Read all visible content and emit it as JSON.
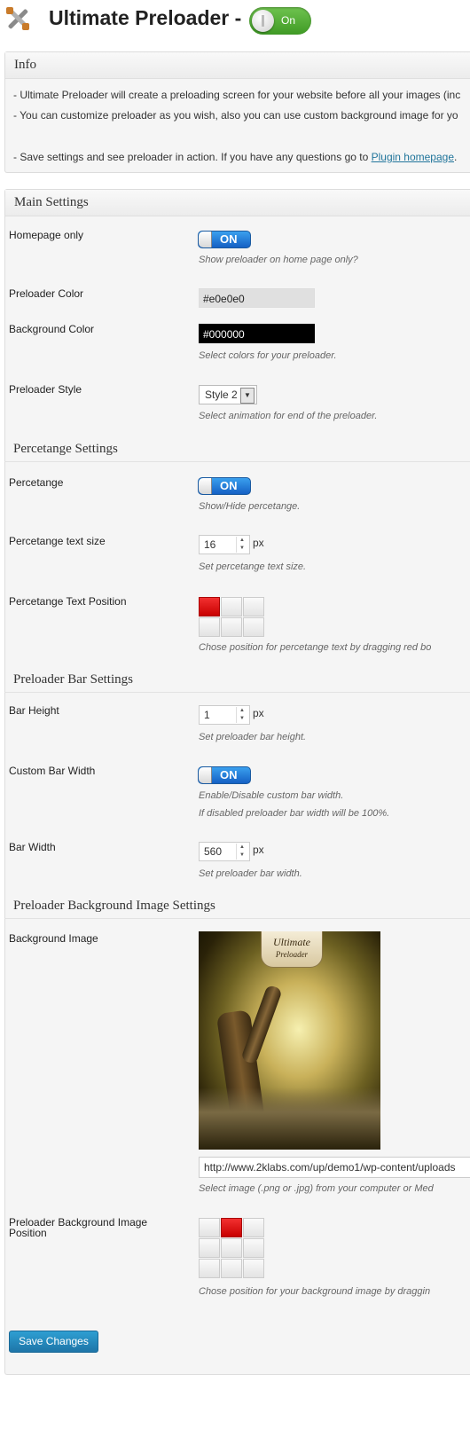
{
  "header": {
    "title": "Ultimate Preloader -",
    "toggle_label": "On",
    "icon": "tools-icon"
  },
  "info": {
    "title": "Info",
    "line1": "- Ultimate Preloader will create a preloading screen for your website before all your images (inc",
    "line2": "- You can customize preloader as you wish, also you can use custom background image for yo",
    "line3_prefix": "- Save settings and see preloader in action. If you have any questions go to ",
    "line3_link": "Plugin homepage",
    "line3_suffix": "."
  },
  "main_settings": {
    "title": "Main Settings",
    "homepage_only": {
      "label": "Homepage only",
      "toggle": "ON",
      "desc": "Show preloader on home page only?"
    },
    "preloader_color": {
      "label": "Preloader Color",
      "value": "#e0e0e0"
    },
    "background_color": {
      "label": "Background Color",
      "value": "#000000",
      "desc": "Select colors for your preloader."
    },
    "preloader_style": {
      "label": "Preloader Style",
      "value": "Style 2",
      "desc": "Select animation for end of the preloader."
    }
  },
  "percentage_settings": {
    "title": "Percetange Settings",
    "percentage": {
      "label": "Percetange",
      "toggle": "ON",
      "desc": "Show/Hide percetange."
    },
    "text_size": {
      "label": "Percetange text size",
      "value": "16",
      "unit": "px",
      "desc": "Set percetange text size."
    },
    "text_position": {
      "label": "Percetange Text Position",
      "desc": "Chose position for percetange text by dragging red bo",
      "selected_cell": 0
    }
  },
  "bar_settings": {
    "title": "Preloader Bar Settings",
    "bar_height": {
      "label": "Bar Height",
      "value": "1",
      "unit": "px",
      "desc": "Set preloader bar height."
    },
    "custom_width": {
      "label": "Custom Bar Width",
      "toggle": "ON",
      "desc1": "Enable/Disable custom bar width.",
      "desc2": "If disabled preloader bar width will be 100%."
    },
    "bar_width": {
      "label": "Bar Width",
      "value": "560",
      "unit": "px",
      "desc": "Set preloader bar width."
    }
  },
  "bg_image_settings": {
    "title": "Preloader Background Image Settings",
    "bg_image": {
      "label": "Background Image",
      "banner_line1": "Ultimate",
      "banner_line2": "Preloader",
      "url": "http://www.2klabs.com/up/demo1/wp-content/uploads",
      "desc": "Select image (.png or .jpg) from your computer or Med"
    },
    "bg_position": {
      "label_line1": "Preloader Background Image",
      "label_line2": "Position",
      "desc": "Chose position for your background image by draggin",
      "selected_cell": 1
    }
  },
  "save_button": "Save Changes",
  "colors": {
    "toggle_blue": "#1560c4",
    "header_toggle_green": "#3f9a25",
    "grid_red": "#c80000",
    "save_blue": "#1e75a8",
    "link_blue": "#21759b"
  }
}
